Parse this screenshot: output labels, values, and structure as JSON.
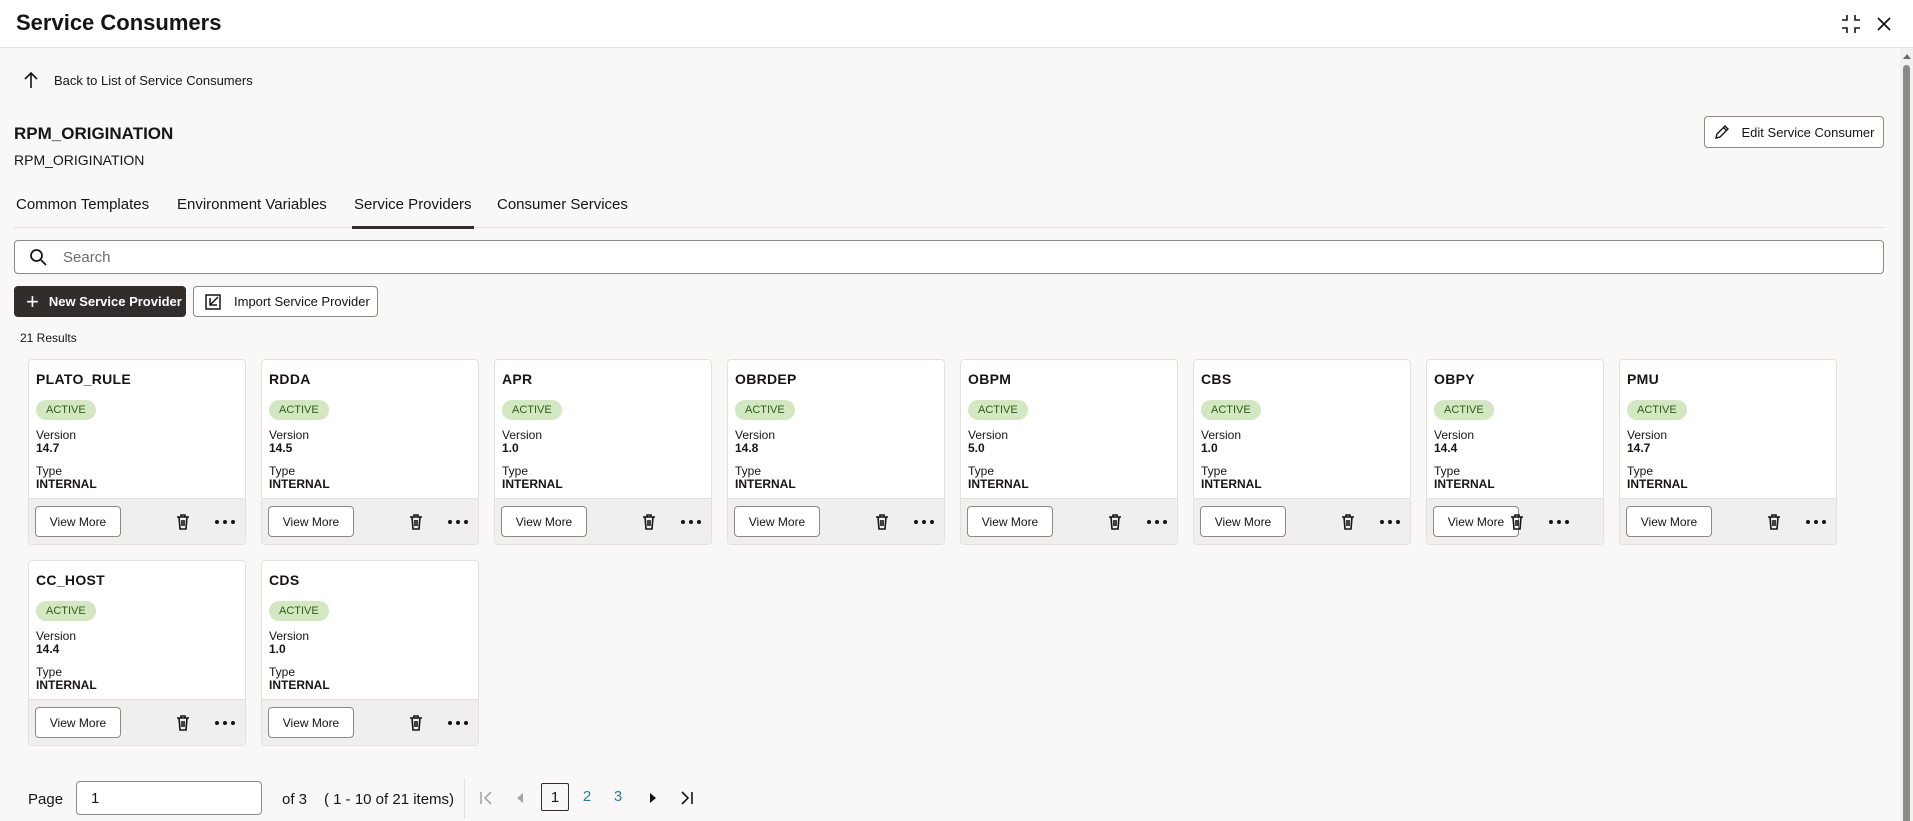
{
  "header": {
    "title": "Service Consumers"
  },
  "back_link": "Back to List of Service Consumers",
  "consumer": {
    "name": "RPM_ORIGINATION",
    "subtitle": "RPM_ORIGINATION"
  },
  "edit_button": "Edit Service Consumer",
  "tabs": [
    {
      "label": "Common Templates"
    },
    {
      "label": "Environment Variables"
    },
    {
      "label": "Service Providers"
    },
    {
      "label": "Consumer Services"
    }
  ],
  "active_tab": "Service Providers",
  "search": {
    "placeholder": "Search",
    "value": ""
  },
  "actions": {
    "new_label": "New Service Provider",
    "import_label": "Import Service Provider"
  },
  "results": "21 Results",
  "card_labels": {
    "version": "Version",
    "type": "Type",
    "view_more": "View More"
  },
  "providers": [
    {
      "name": "PLATO_RULE",
      "status": "ACTIVE",
      "version": "14.7",
      "type": "INTERNAL"
    },
    {
      "name": "RDDA",
      "status": "ACTIVE",
      "version": "14.5",
      "type": "INTERNAL"
    },
    {
      "name": "APR",
      "status": "ACTIVE",
      "version": "1.0",
      "type": "INTERNAL"
    },
    {
      "name": "OBRDEP",
      "status": "ACTIVE",
      "version": "14.8",
      "type": "INTERNAL"
    },
    {
      "name": "OBPM",
      "status": "ACTIVE",
      "version": "5.0",
      "type": "INTERNAL"
    },
    {
      "name": "CBS",
      "status": "ACTIVE",
      "version": "1.0",
      "type": "INTERNAL"
    },
    {
      "name": "OBPY",
      "status": "ACTIVE",
      "version": "14.4",
      "type": "INTERNAL"
    },
    {
      "name": "PMU",
      "status": "ACTIVE",
      "version": "14.7",
      "type": "INTERNAL"
    },
    {
      "name": "CC_HOST",
      "status": "ACTIVE",
      "version": "14.4",
      "type": "INTERNAL"
    },
    {
      "name": "CDS",
      "status": "ACTIVE",
      "version": "1.0",
      "type": "INTERNAL"
    }
  ],
  "pagination": {
    "page_label": "Page",
    "current_page": "1",
    "of_label": "of 3",
    "range_label": "( 1 - 10 of 21 items)",
    "pages": [
      "1",
      "2",
      "3"
    ]
  },
  "colors": {
    "primary_dark": "#312d2a",
    "badge_bg": "#d3e8c2",
    "badge_text": "#2f5d12",
    "link": "#227e9e"
  }
}
